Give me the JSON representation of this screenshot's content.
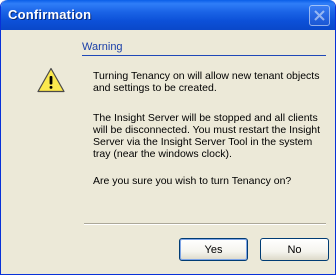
{
  "window": {
    "title": "Confirmation",
    "titlebar_color": "#0c50d8",
    "close_icon": "close-icon"
  },
  "dialog": {
    "header": "Warning",
    "icon": "warning-icon",
    "messages": [
      "Turning Tenancy on will allow new tenant objects and settings to be created.",
      "The Insight Server will be stopped and all clients will be disconnected. You must restart the Insight Server via the Insight Server Tool in the system tray (near the windows clock).",
      "Are you sure you wish to turn Tenancy on?"
    ]
  },
  "buttons": {
    "yes_label": "Yes",
    "no_label": "No"
  }
}
